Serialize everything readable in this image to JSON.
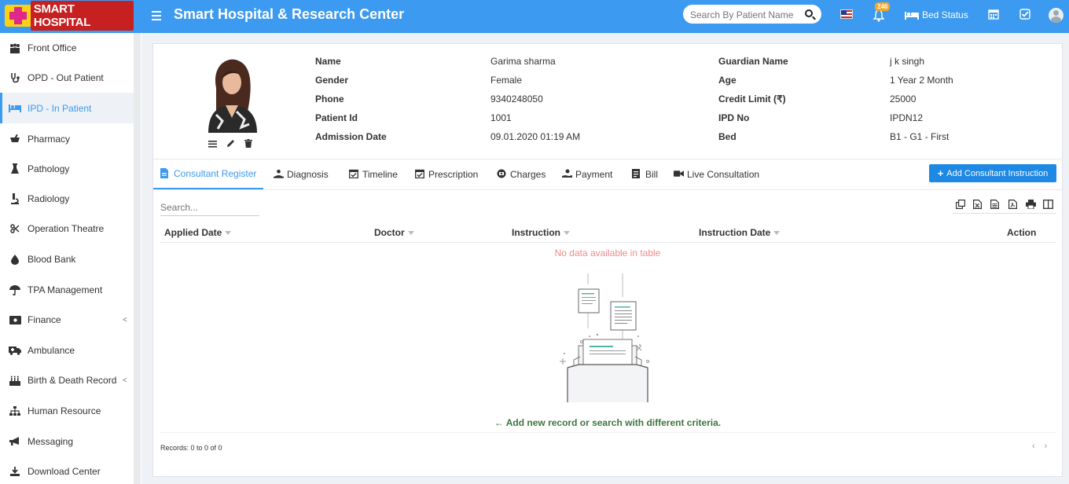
{
  "header": {
    "logo_text": "SMART HOSPITAL",
    "title": "Smart Hospital & Research Center",
    "search_placeholder": "Search By Patient Name",
    "notification_count": "246",
    "bed_status": "Bed Status"
  },
  "sidebar": {
    "items": [
      {
        "label": "Front Office",
        "icon": "front-office-icon"
      },
      {
        "label": "OPD - Out Patient",
        "icon": "stethoscope-icon"
      },
      {
        "label": "IPD - In Patient",
        "icon": "bed-icon"
      },
      {
        "label": "Pharmacy",
        "icon": "mortar-icon"
      },
      {
        "label": "Pathology",
        "icon": "flask-icon"
      },
      {
        "label": "Radiology",
        "icon": "microscope-icon"
      },
      {
        "label": "Operation Theatre",
        "icon": "scissors-icon"
      },
      {
        "label": "Blood Bank",
        "icon": "droplet-icon"
      },
      {
        "label": "TPA Management",
        "icon": "umbrella-icon"
      },
      {
        "label": "Finance",
        "icon": "money-icon"
      },
      {
        "label": "Ambulance",
        "icon": "ambulance-icon"
      },
      {
        "label": "Birth & Death Record",
        "icon": "birthday-icon"
      },
      {
        "label": "Human Resource",
        "icon": "sitemap-icon"
      },
      {
        "label": "Messaging",
        "icon": "bullhorn-icon"
      },
      {
        "label": "Download Center",
        "icon": "download-icon"
      }
    ],
    "active_index": 2
  },
  "patient": {
    "labels": {
      "name": "Name",
      "gender": "Gender",
      "phone": "Phone",
      "patient_id": "Patient Id",
      "admission_date": "Admission Date",
      "guardian_name": "Guardian Name",
      "age": "Age",
      "credit_limit": "Credit Limit (₹)",
      "ipd_no": "IPD No",
      "bed": "Bed"
    },
    "values": {
      "name": "Garima sharma",
      "gender": "Female",
      "phone": "9340248050",
      "patient_id": "1001",
      "admission_date": "09.01.2020 01:19 AM",
      "guardian_name": "j k singh",
      "age": "1 Year 2 Month",
      "credit_limit": "25000",
      "ipd_no": "IPDN12",
      "bed": "B1 - G1 - First"
    }
  },
  "tabs": [
    {
      "label": "Consultant Register",
      "icon": "file-icon"
    },
    {
      "label": "Diagnosis",
      "icon": "diagnosis-icon"
    },
    {
      "label": "Timeline",
      "icon": "calendar-check-icon"
    },
    {
      "label": "Prescription",
      "icon": "calendar-check-icon"
    },
    {
      "label": "Charges",
      "icon": "money-icon"
    },
    {
      "label": "Payment",
      "icon": "hand-money-icon"
    },
    {
      "label": "Bill",
      "icon": "bill-icon"
    },
    {
      "label": "Live Consultation",
      "icon": "video-icon"
    }
  ],
  "add_button": "Add Consultant Instruction",
  "table": {
    "search_placeholder": "Search...",
    "columns": [
      "Applied Date",
      "Doctor",
      "Instruction",
      "Instruction Date",
      "Action"
    ],
    "empty_text": "No data available in table",
    "add_new_text": "Add new record or search with different criteria.",
    "records": "Records: 0 to 0 of 0",
    "pager_prev": "‹",
    "pager_next": "›"
  },
  "colors": {
    "brand": "#3c9af0",
    "logo_bg": "#fbd117",
    "button": "#1e88e5",
    "empty_text": "#f08a8a",
    "add_new_text": "#3c763d"
  }
}
